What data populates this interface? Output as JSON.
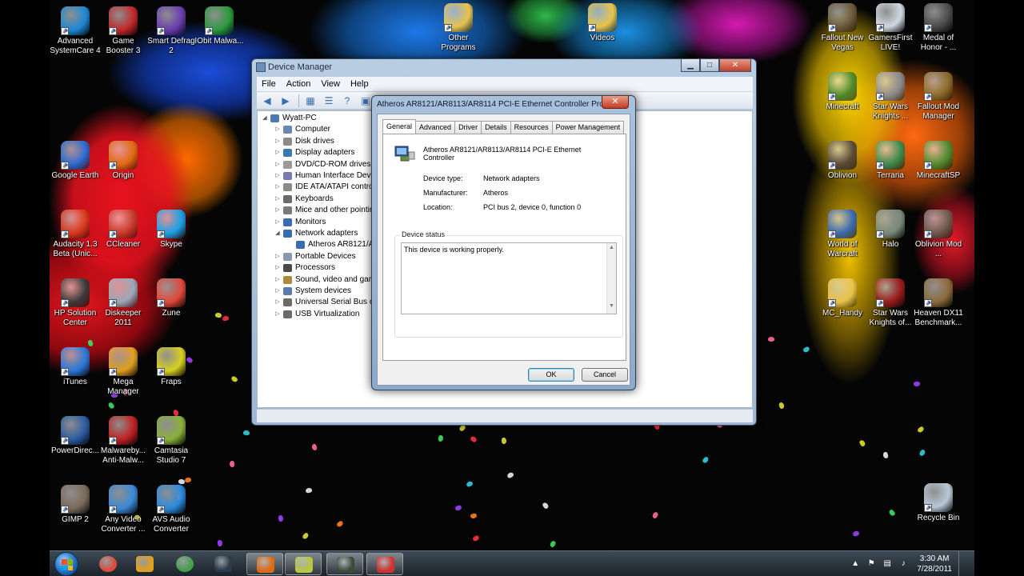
{
  "desktop_icons": [
    {
      "label": "Advanced SystemCare 4",
      "color": "#1d88d6"
    },
    {
      "label": "Game Booster 3",
      "color": "#c0282a"
    },
    {
      "label": "Smart Defrag 2",
      "color": "#6a3cb0"
    },
    {
      "label": "IObit Malwa...",
      "color": "#2a9a3c"
    },
    {
      "label": "Other Programs",
      "color": "#e8c24a"
    },
    {
      "label": "Videos",
      "color": "#e8c24a"
    },
    {
      "label": "Fallout New Vegas",
      "color": "#6b5a3a"
    },
    {
      "label": "GamersFirst LIVE!",
      "color": "#cfd8e2"
    },
    {
      "label": "Medal of Honor - ...",
      "color": "#4a4a4a"
    },
    {
      "label": "Minecraft",
      "color": "#4e8a2e"
    },
    {
      "label": "Star Wars Knights ...",
      "color": "#8a8a8a"
    },
    {
      "label": "Fallout Mod Manager",
      "color": "#8a6a2a"
    },
    {
      "label": "Google Earth",
      "color": "#2a6ad0"
    },
    {
      "label": "Origin",
      "color": "#e06a10"
    },
    {
      "label": "Oblivion",
      "color": "#5a4a3a"
    },
    {
      "label": "Terraria",
      "color": "#3a8a4a"
    },
    {
      "label": "MinecraftSP",
      "color": "#4e8a2e"
    },
    {
      "label": "Audacity 1.3 Beta (Unic...",
      "color": "#d8381c"
    },
    {
      "label": "CCleaner",
      "color": "#c83a2a"
    },
    {
      "label": "Skype",
      "color": "#1aa0e6"
    },
    {
      "label": "World of Warcraft",
      "color": "#3a6ab0"
    },
    {
      "label": "Halo",
      "color": "#7a8a7a"
    },
    {
      "label": "Oblivion Mod ...",
      "color": "#6a5a4a"
    },
    {
      "label": "HP Solution Center",
      "color": "#3a3a3a"
    },
    {
      "label": "Diskeeper 2011",
      "color": "#9aa8b8"
    },
    {
      "label": "Zune",
      "color": "#e0483a"
    },
    {
      "label": "MC_Handy",
      "color": "#e8c24a"
    },
    {
      "label": "Star Wars Knights of...",
      "color": "#9a1a1a"
    },
    {
      "label": "Heaven DX11 Benchmark...",
      "color": "#8a6a3a"
    },
    {
      "label": "iTunes",
      "color": "#2a78d8"
    },
    {
      "label": "Mega Manager",
      "color": "#e0a020"
    },
    {
      "label": "Fraps",
      "color": "#d8d020"
    },
    {
      "label": "PowerDirec...",
      "color": "#2a5aa0"
    },
    {
      "label": "Malwareby... Anti-Malw...",
      "color": "#c02020"
    },
    {
      "label": "Camtasia Studio 7",
      "color": "#8ab03a"
    },
    {
      "label": "GIMP 2",
      "color": "#7a6a5a"
    },
    {
      "label": "Any Video Converter ...",
      "color": "#3a8ad8"
    },
    {
      "label": "AVS Audio Converter",
      "color": "#2a8ae0"
    },
    {
      "label": "Recycle Bin",
      "color": "#b8c8d8"
    }
  ],
  "device_manager": {
    "title": "Device Manager",
    "caption": {
      "minimize": "▁",
      "maximize": "□",
      "close": "✕"
    },
    "menu": [
      "File",
      "Action",
      "View",
      "Help"
    ],
    "toolbar_icons": [
      "back-icon",
      "forward-icon",
      "properties-grid-icon",
      "list-icon",
      "help-icon",
      "scan-icon"
    ],
    "toolbar_glyphs": {
      "back": "◀",
      "forward": "▶",
      "grid": "▦",
      "list": "☰",
      "help": "?",
      "scan": "▣"
    },
    "tree": {
      "root": "Wyatt-PC",
      "items": [
        {
          "label": "Computer",
          "expander": "▷"
        },
        {
          "label": "Disk drives",
          "expander": "▷"
        },
        {
          "label": "Display adapters",
          "expander": "▷"
        },
        {
          "label": "DVD/CD-ROM drives",
          "expander": "▷"
        },
        {
          "label": "Human Interface Devic",
          "expander": "▷"
        },
        {
          "label": "IDE ATA/ATAPI contro",
          "expander": "▷"
        },
        {
          "label": "Keyboards",
          "expander": "▷"
        },
        {
          "label": "Mice and other pointin",
          "expander": "▷"
        },
        {
          "label": "Monitors",
          "expander": "▷"
        },
        {
          "label": "Network adapters",
          "expander": "◢"
        },
        {
          "label": "Atheros AR8121/AR",
          "expander": "",
          "child": true
        },
        {
          "label": "Portable Devices",
          "expander": "▷"
        },
        {
          "label": "Processors",
          "expander": "▷"
        },
        {
          "label": "Sound, video and gam",
          "expander": "▷"
        },
        {
          "label": "System devices",
          "expander": "▷"
        },
        {
          "label": "Universal Serial Bus co",
          "expander": "▷"
        },
        {
          "label": "USB Virtualization",
          "expander": "▷"
        }
      ],
      "root_expander": "◢"
    }
  },
  "dialog": {
    "title": "Atheros AR8121/AR8113/AR8114 PCI-E Ethernet Controller Prop...",
    "close": "✕",
    "tabs": [
      "General",
      "Advanced",
      "Driver",
      "Details",
      "Resources",
      "Power Management"
    ],
    "active_tab": "General",
    "device_name": "Atheros AR8121/AR8113/AR8114 PCI-E Ethernet Controller",
    "properties": [
      {
        "label": "Device type:",
        "value": "Network adapters"
      },
      {
        "label": "Manufacturer:",
        "value": "Atheros"
      },
      {
        "label": "Location:",
        "value": "PCI bus 2, device 0, function 0"
      }
    ],
    "status_group": "Device status",
    "status_text": "This device is working properly.",
    "scroll": {
      "up": "▲",
      "down": "▼"
    },
    "ok_label": "OK",
    "cancel_label": "Cancel"
  },
  "taskbar": {
    "apps": [
      "chrome-icon",
      "winamp-icon",
      "utorrent-icon",
      "steam-icon",
      "origin-icon",
      "camtasia-icon",
      "recorder-icon",
      "device-manager-icon"
    ],
    "tray": {
      "chevron": "▲",
      "flag": "⚑",
      "network": "▤",
      "volume": "♪"
    },
    "clock_time": "3:30 AM",
    "clock_date": "7/28/2011"
  },
  "colors": {
    "desktop": "#050505",
    "taskbar": "#1b232b",
    "accent": "#1f6fc4"
  }
}
